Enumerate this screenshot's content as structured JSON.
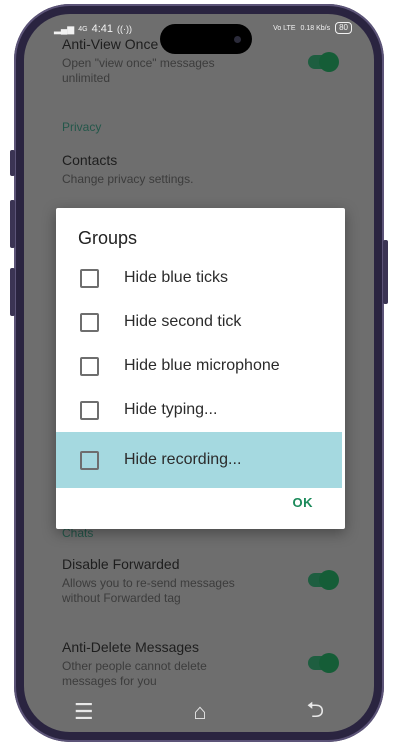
{
  "status_bar": {
    "network": "4G",
    "time": "4:41",
    "extra_icon": "radio-waves-icon",
    "volte": "Vo LTE",
    "speed": "0.18 Kb/s",
    "battery": "80"
  },
  "background": {
    "item_anti_view": {
      "title": "Anti-View Once",
      "subtitle": "Open \"view once\" messages unlimited",
      "toggle_on": true
    },
    "privacy_section": "Privacy",
    "item_contacts": {
      "title": "Contacts",
      "subtitle": "Change privacy settings."
    },
    "chats_section": "Chats",
    "item_disable_forwarded": {
      "title": "Disable Forwarded",
      "subtitle": "Allows you to re-send messages without Forwarded tag",
      "toggle_on": true
    },
    "item_anti_delete": {
      "title": "Anti-Delete Messages",
      "subtitle": "Other people cannot delete messages for you",
      "toggle_on": true
    }
  },
  "dialog": {
    "title": "Groups",
    "options": [
      {
        "label": "Hide blue ticks",
        "checked": false
      },
      {
        "label": "Hide second tick",
        "checked": false
      },
      {
        "label": "Hide blue microphone",
        "checked": false
      },
      {
        "label": "Hide typing...",
        "checked": false
      },
      {
        "label": "Hide recording...",
        "checked": false,
        "highlighted": true
      }
    ],
    "ok_label": "OK"
  },
  "nav_bar": {
    "menu_icon": "☰",
    "home_icon": "⌂",
    "back_icon": "⮌"
  },
  "colors": {
    "accent": "#1b8a5a",
    "highlight": "#a5d9e0",
    "overlay_bg": "#6e6e6e"
  }
}
